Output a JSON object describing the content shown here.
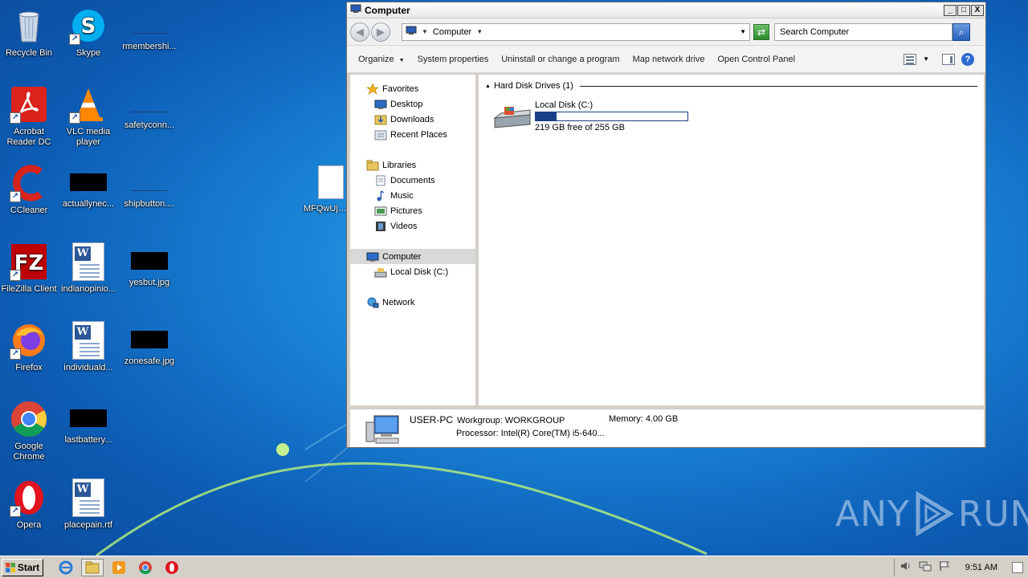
{
  "desktop": {
    "icons": [
      {
        "label": "Recycle Bin"
      },
      {
        "label": "Skype"
      },
      {
        "label": "rmembershi..."
      },
      {
        "label": "Acrobat Reader DC"
      },
      {
        "label": "VLC media player"
      },
      {
        "label": "safetyconn..."
      },
      {
        "label": "CCleaner"
      },
      {
        "label": "actuallynec..."
      },
      {
        "label": "shipbutton...."
      },
      {
        "label": "MFQwUjBC"
      },
      {
        "label": "FileZilla Client"
      },
      {
        "label": "indianopinio..."
      },
      {
        "label": "yesbut.jpg"
      },
      {
        "label": "Firefox"
      },
      {
        "label": "individuald..."
      },
      {
        "label": "zonesafe.jpg"
      },
      {
        "label": "Google Chrome"
      },
      {
        "label": "lastbattery..."
      },
      {
        "label": "Opera"
      },
      {
        "label": "placepain.rtf"
      }
    ]
  },
  "window": {
    "title": "Computer",
    "controls": {
      "minimize": "_",
      "maximize": "□",
      "close": "X"
    },
    "address": {
      "location": "Computer"
    },
    "search": {
      "placeholder": "Search Computer"
    },
    "toolbar": {
      "organize": "Organize",
      "system_properties": "System properties",
      "uninstall": "Uninstall or change a program",
      "map_network": "Map network drive",
      "control_panel": "Open Control Panel"
    },
    "nav": {
      "favorites": "Favorites",
      "desktop": "Desktop",
      "downloads": "Downloads",
      "recent": "Recent Places",
      "libraries": "Libraries",
      "documents": "Documents",
      "music": "Music",
      "pictures": "Pictures",
      "videos": "Videos",
      "computer": "Computer",
      "local_disk": "Local Disk (C:)",
      "network": "Network"
    },
    "content": {
      "group_title": "Hard Disk Drives (1)",
      "disk_name": "Local Disk (C:)",
      "disk_free": "219 GB free of 255 GB",
      "disk_used_fraction": 0.14
    },
    "details": {
      "pc_name": "USER-PC",
      "workgroup_label": "Workgroup:",
      "workgroup": "WORKGROUP",
      "memory_label": "Memory:",
      "memory": "4.00 GB",
      "processor_label": "Processor:",
      "processor": "Intel(R) Core(TM) i5-640..."
    }
  },
  "taskbar": {
    "start_label": "Start",
    "clock": "9:51 AM"
  },
  "watermark": {
    "left": "ANY",
    "right": "RUN"
  },
  "colors": {
    "accent": "#1a3f86",
    "taskbar": "#d4d0c8"
  }
}
